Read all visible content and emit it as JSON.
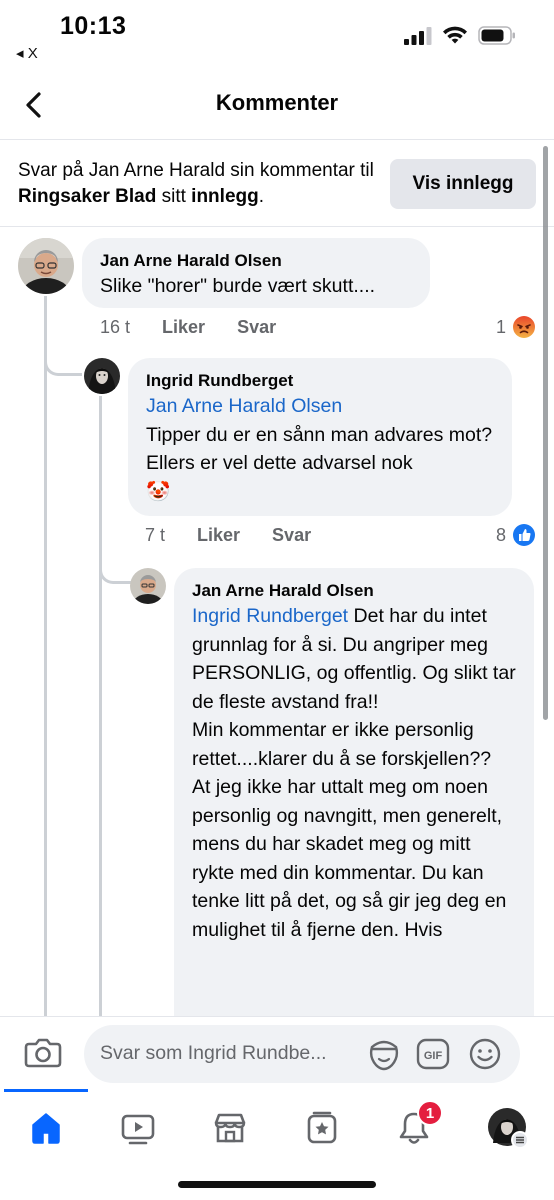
{
  "status_bar": {
    "time": "10:13",
    "back_app": "◂ X"
  },
  "header": {
    "title": "Kommenter"
  },
  "context": {
    "prefix": "Svar på Jan Arne Harald sin kommentar til ",
    "page_name": "Ringsaker Blad",
    "middle": " sitt ",
    "post_word": "innlegg",
    "suffix": ".",
    "view_post_label": "Vis innlegg"
  },
  "comments": [
    {
      "author": "Jan Arne Harald Olsen",
      "text": "Slike \"horer\" burde vært skutt....",
      "time": "16 t",
      "like_label": "Liker",
      "reply_label": "Svar",
      "reaction_count": "1",
      "reaction_icon": "angry-face-icon"
    },
    {
      "author": "Ingrid Rundberget",
      "mention": "Jan Arne Harald Olsen",
      "text": "Tipper du er en sånn man advares mot? Ellers er vel dette advarsel nok\n🤡",
      "time": "7 t",
      "like_label": "Liker",
      "reply_label": "Svar",
      "reaction_count": "8",
      "reaction_icon": "thumbs-up-icon"
    },
    {
      "author": "Jan Arne Harald Olsen",
      "mention": "Ingrid Rundberget",
      "text": " Det har du intet grunnlag for å si. Du angriper meg PERSONLIG, og offentlig. Og slikt tar de fleste avstand fra!!\nMin kommentar er ikke personlig rettet....klarer du å se forskjellen??\nAt jeg ikke har uttalt meg om noen personlig og navngitt, men generelt,\nmens du har skadet meg og mitt rykte med din kommentar. Du kan tenke litt på det, og så gir jeg deg en mulighet til å fjerne den. Hvis"
    }
  ],
  "composer": {
    "placeholder": "Svar som Ingrid Rundbe..."
  },
  "tabbar": {
    "notification_count": "1"
  },
  "colors": {
    "accent": "#0866ff",
    "mention": "#1b67c9",
    "badge": "#e41e3f",
    "bubble": "#f0f2f5"
  }
}
